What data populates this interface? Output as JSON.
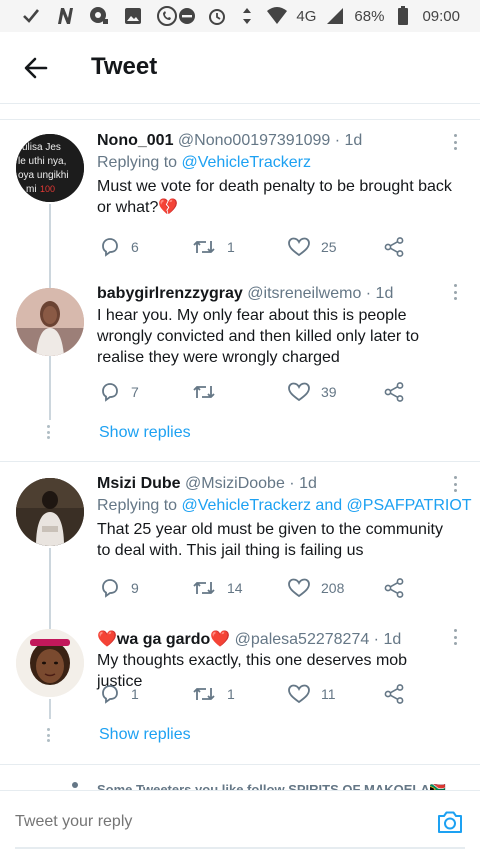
{
  "status_bar": {
    "network": "4G",
    "battery": "68%",
    "time": "09:00"
  },
  "header": {
    "title": "Tweet"
  },
  "tweets": [
    {
      "name": "Nono_001",
      "handle": "@Nono00197391099 · 1d",
      "replying_prefix": "Replying to ",
      "replying_to": "@VehicleTrackerz",
      "text": "Must we vote for death penalty to be brought back or what?💔",
      "avatar_text": "ulisa Jes\nle uthi nya,\noya ungikhi\nmi 💯",
      "replies": "6",
      "retweets": "1",
      "likes": "25"
    },
    {
      "name": "babygirlrenzzygray",
      "handle": "@itsreneilwemo · 1d",
      "text": "I hear you. My only fear about this is people wrongly convicted and then killed only later to realise they were wrongly charged",
      "replies": "7",
      "retweets": "",
      "likes": "39",
      "show_replies": "Show replies"
    },
    {
      "name": "Msizi Dube",
      "handle": "@MsiziDoobe · 1d",
      "replying_prefix": "Replying to ",
      "replying_to": "@VehicleTrackerz and @PSAFPATRIOT",
      "text": "That 25 year old must be given to the community to deal with. This jail thing is failing us",
      "replies": "9",
      "retweets": "14",
      "likes": "208"
    },
    {
      "name": "❤️wa ga gardo❤️",
      "handle": "@palesa52278274 · 1d",
      "text": "My thoughts exactly, this one deserves mob justice",
      "replies": "1",
      "retweets": "1",
      "likes": "11",
      "show_replies": "Show replies"
    }
  ],
  "suggestion": "Some Tweeters you like follow SPIRITS OF MAKOELA🇿🇦",
  "reply_bar": {
    "placeholder": "Tweet your reply"
  },
  "colors": {
    "accent": "#1da1f2",
    "muted": "#657786",
    "heart": "#e0245e"
  }
}
